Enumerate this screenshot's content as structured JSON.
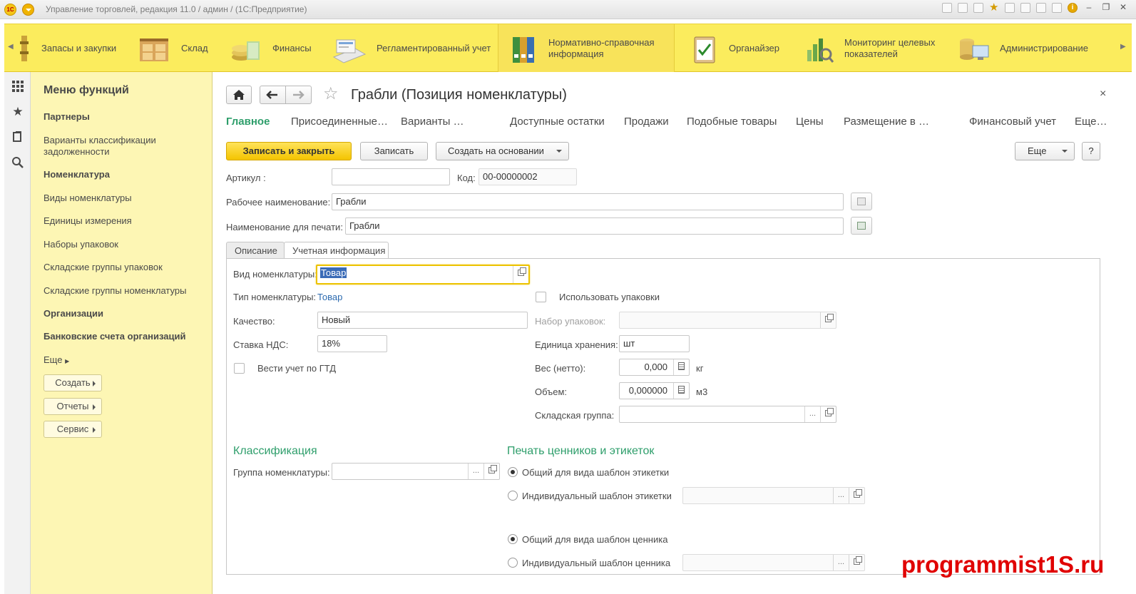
{
  "titlebar": {
    "logo": "1С",
    "title": "Управление торговлей, редакция 11.0 / админ /  (1С:Предприятие)"
  },
  "sections": [
    {
      "label": "Запасы и закупки",
      "icon": "warehouse-stock-icon"
    },
    {
      "label": "Склад",
      "icon": "boxes-icon"
    },
    {
      "label": "Финансы",
      "icon": "coins-icon"
    },
    {
      "label": "Регламентированный учет",
      "icon": "calculator-docs-icon"
    },
    {
      "label": "Нормативно-справочная информация",
      "icon": "binders-icon",
      "active": true
    },
    {
      "label": "Органайзер",
      "icon": "clipboard-check-icon"
    },
    {
      "label": "Мониторинг целевых показателей",
      "icon": "chart-magnifier-icon"
    },
    {
      "label": "Администрирование",
      "icon": "admin-computer-icon"
    }
  ],
  "menu": {
    "title": "Меню функций",
    "items": [
      {
        "label": "Партнеры",
        "bold": true
      },
      {
        "label": "Варианты классификации задолженности",
        "bold": false
      },
      {
        "label": "Номенклатура",
        "bold": true
      },
      {
        "label": "Виды номенклатуры",
        "bold": false
      },
      {
        "label": "Единицы измерения",
        "bold": false
      },
      {
        "label": "Наборы упаковок",
        "bold": false
      },
      {
        "label": "Складские группы упаковок",
        "bold": false
      },
      {
        "label": "Складские группы номенклатуры",
        "bold": false
      },
      {
        "label": "Организации",
        "bold": true
      },
      {
        "label": "Банковские счета организаций",
        "bold": true
      }
    ],
    "more": "Еще",
    "buttons": [
      "Создать",
      "Отчеты",
      "Сервис"
    ]
  },
  "form": {
    "title": "Грабли (Позиция номенклатуры)",
    "close": "×",
    "tabs": [
      "Главное",
      "Присоединенные…",
      "Варианты …",
      "Доступные остатки",
      "Продажи",
      "Подобные товары",
      "Цены",
      "Размещение в …",
      "Финансовый учет",
      "Еще…"
    ],
    "toolbar": {
      "save_close": "Записать и закрыть",
      "save": "Записать",
      "create_based": "Создать на основании",
      "more": "Еще",
      "help": "?"
    },
    "fields": {
      "article_label": "Артикул :",
      "article_value": "",
      "code_label": "Код:",
      "code_value": "00-00000002",
      "work_name_label": "Рабочее наименование:",
      "work_name_value": "Грабли",
      "print_name_label": "Наименование для печати:",
      "print_name_value": "Грабли"
    },
    "subtabs": [
      "Описание",
      "Учетная информация"
    ],
    "accounting": {
      "kind_label": "Вид номенклатуры:",
      "kind_value": "Товар",
      "type_label": "Тип номенклатуры:",
      "type_value": "Товар",
      "quality_label": "Качество:",
      "quality_value": "Новый",
      "vat_label": "Ставка НДС:",
      "vat_value": "18%",
      "gtd_label": "Вести учет по ГТД",
      "use_packs_label": "Использовать упаковки",
      "pack_set_label": "Набор упаковок:",
      "pack_set_value": "",
      "storage_unit_label": "Единица хранения:",
      "storage_unit_value": "шт",
      "weight_label": "Вес (нетто):",
      "weight_value": "0,000",
      "weight_unit": "кг",
      "volume_label": "Объем:",
      "volume_value": "0,000000",
      "volume_unit": "м3",
      "wh_group_label": "Складская группа:",
      "wh_group_value": "",
      "classification_title": "Классификация",
      "group_label": "Группа номенклатуры:",
      "group_value": "",
      "print_title": "Печать ценников и этикеток",
      "radio_label_common": "Общий для вида шаблон этикетки",
      "radio_label_individual": "Индивидуальный шаблон этикетки",
      "radio_price_common": "Общий для вида шаблон ценника",
      "radio_price_individual": "Индивидуальный шаблон ценника"
    }
  },
  "watermark": "programmist1S.ru",
  "colors": {
    "accent_yellow": "#fbec5d",
    "green_title": "#2e9e6b",
    "link_blue": "#2d6bb0"
  }
}
